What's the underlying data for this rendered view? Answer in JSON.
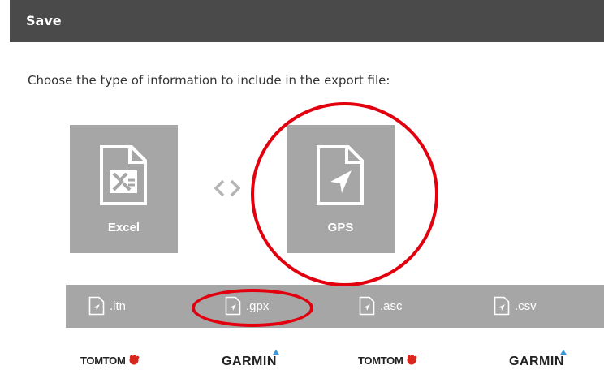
{
  "dialog": {
    "title": "Save"
  },
  "instruction": "Choose the type of information to include in the export file:",
  "options": [
    {
      "label": "Excel",
      "icon": "excel-file-icon"
    },
    {
      "label": "GPS",
      "icon": "gps-file-icon",
      "highlighted": true
    }
  ],
  "swap_icon": "swap-arrows-icon",
  "formats": [
    {
      "label": ".itn",
      "icon": "file-navigation-icon"
    },
    {
      "label": ".gpx",
      "icon": "file-navigation-icon",
      "highlighted": true
    },
    {
      "label": ".asc",
      "icon": "file-navigation-icon"
    },
    {
      "label": ".csv",
      "icon": "file-navigation-icon"
    }
  ],
  "brands": [
    {
      "logo_text": "TOMTOM",
      "mark": "tomtom-hand-logo"
    },
    {
      "logo_text": "GARMIN",
      "mark": "garmin-triangle-logo"
    },
    {
      "logo_text": "TOMTOM",
      "mark": "tomtom-hand-logo"
    },
    {
      "logo_text": "GARMIN",
      "mark": "garmin-triangle-logo"
    }
  ],
  "colors": {
    "header_bg": "#4a4a4a",
    "tile_bg": "#a6a6a6",
    "annotation": "#e2000f",
    "garmin_accent": "#3a9ad9"
  }
}
